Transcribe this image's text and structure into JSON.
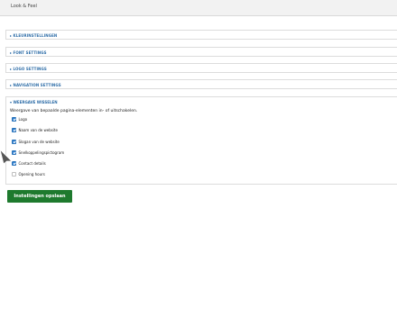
{
  "header": {
    "tab_label": "Look & Feel"
  },
  "sections": [
    {
      "label": "KLEURINSTELLINGEN"
    },
    {
      "label": "FONT SETTINGS"
    },
    {
      "label": "LOGO SETTINGS"
    },
    {
      "label": "NAVIGATION SETTINGS"
    }
  ],
  "display_section": {
    "label": "WEERGAVE WISSELEN",
    "description": "Weergave van bepaalde pagina-elementen in- of uitschakelen.",
    "options": [
      {
        "label": "Logo",
        "checked": true
      },
      {
        "label": "Naam van de website",
        "checked": true
      },
      {
        "label": "Slogan van de website",
        "checked": true
      },
      {
        "label": "Snelkoppelingspictogram",
        "checked": true
      },
      {
        "label": "Contact details",
        "checked": true
      },
      {
        "label": "Opening hours",
        "checked": false
      }
    ]
  },
  "actions": {
    "save_label": "Instellingen opslaan"
  },
  "colors": {
    "link": "#2f6ea8",
    "checkbox": "#2f7fd0",
    "save_button": "#1e7a2e"
  }
}
